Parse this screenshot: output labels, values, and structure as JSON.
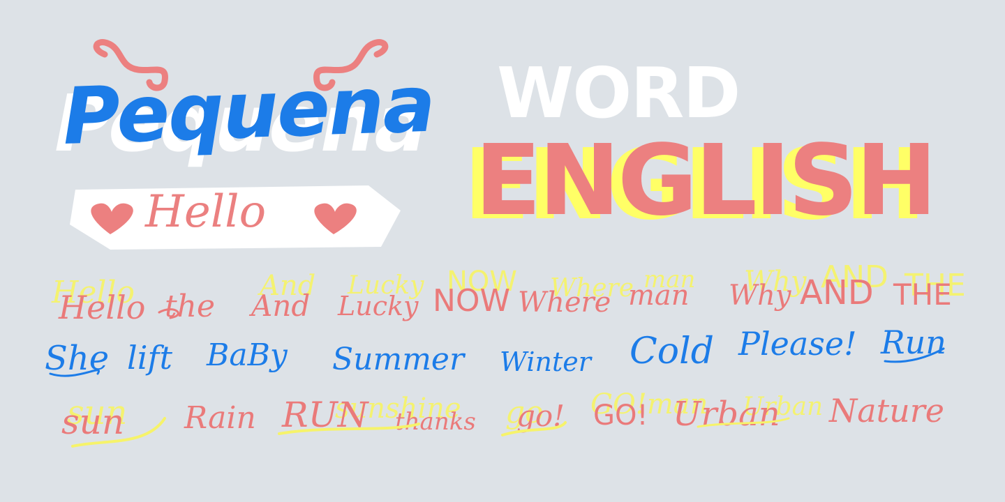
{
  "headline": {
    "pequena": "Pequena",
    "hello": "Hello",
    "word": "WORD",
    "english": "ENGLISH"
  },
  "row1": [
    "Hello",
    "the",
    "And",
    "Lucky",
    "NOW",
    "Where",
    "man",
    "Why",
    "AND",
    "THE"
  ],
  "row2": [
    "She",
    "lift",
    "BaBy",
    "Summer",
    "Winter",
    "Cold",
    "Please!",
    "Run"
  ],
  "row3": [
    "sun",
    "Rain",
    "RUN",
    "thanks",
    "go!",
    "GO!",
    "Urban",
    "Nature"
  ],
  "ghost_row3": [
    "sun",
    "sunshine",
    "go",
    "GO!man",
    "Urban"
  ],
  "colors": {
    "background": "#dde2e7",
    "blue": "#1c7ce8",
    "pink": "#ec8080",
    "yellow": "#f6f36a",
    "white": "#ffffff"
  }
}
